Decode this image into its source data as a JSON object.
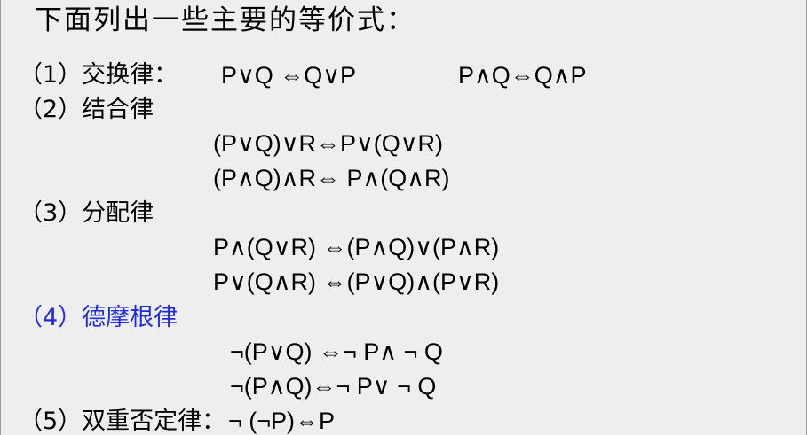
{
  "title": "下面列出一些主要的等价式：",
  "accent_color": "#1f2be0",
  "laws": [
    {
      "label": "（1）交换律：",
      "formulas": [
        "P∨Q ⇔Q∨P",
        "P∧Q⇔Q∧P"
      ]
    },
    {
      "label": "（2）结合律",
      "formulas": [
        "(P∨Q)∨R⇔P∨(Q∨R)",
        "(P∧Q)∧R⇔ P∧(Q∧R)"
      ]
    },
    {
      "label": "（3）分配律",
      "formulas": [
        "P∧(Q∨R) ⇔(P∧Q)∨(P∧R)",
        "P∨(Q∧R) ⇔(P∨Q)∧(P∨R)"
      ]
    },
    {
      "label": "（4）德摩根律",
      "formulas": [
        "¬(P∨Q) ⇔¬ P∧ ¬ Q",
        "¬(P∧Q)⇔¬ P∨ ¬ Q"
      ]
    },
    {
      "label": "（5）双重否定律：",
      "formulas": [
        "¬ (¬P)⇔P"
      ]
    }
  ]
}
